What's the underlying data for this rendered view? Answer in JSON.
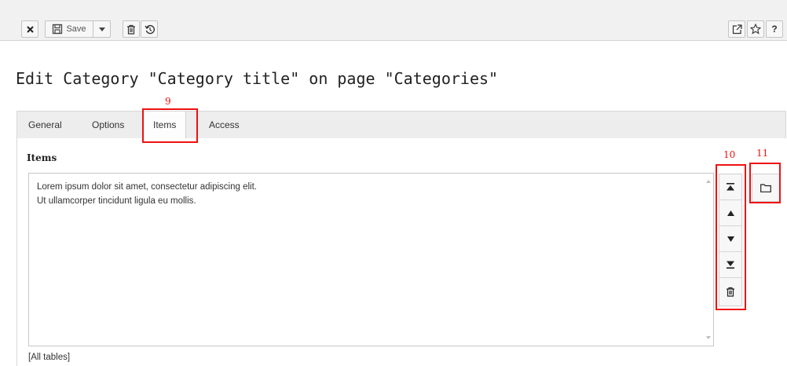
{
  "toolbar": {
    "save_label": "Save",
    "left_icons": [
      "close-icon",
      "save-icon",
      "chevron-down-icon",
      "trash-icon",
      "history-icon"
    ],
    "right_icons": [
      "open-new-window-icon",
      "star-icon",
      "help-icon"
    ],
    "help_label": "?"
  },
  "page": {
    "title": "Edit Category \"Category title\" on page \"Categories\""
  },
  "tabs": [
    {
      "label": "General",
      "active": false
    },
    {
      "label": "Options",
      "active": false
    },
    {
      "label": "Items",
      "active": true
    },
    {
      "label": "Access",
      "active": false
    }
  ],
  "items_field": {
    "label": "Items",
    "lines": [
      "Lorem ipsum dolor sit amet, consectetur adipiscing elit.",
      "Ut ullamcorper tincidunt ligula eu mollis."
    ],
    "allowed_tables": "[All tables]"
  },
  "item_controls": [
    "move-to-top-icon",
    "move-up-icon",
    "move-down-icon",
    "move-to-bottom-icon",
    "delete-icon"
  ],
  "browse_icon": "folder-icon",
  "annotations": {
    "tab_marker": "9",
    "controls_marker": "10",
    "browse_marker": "11"
  },
  "colors": {
    "annotation": "#ee1111",
    "toolbar_bg": "#f1f1f1",
    "tabbar_bg": "#ededed"
  }
}
